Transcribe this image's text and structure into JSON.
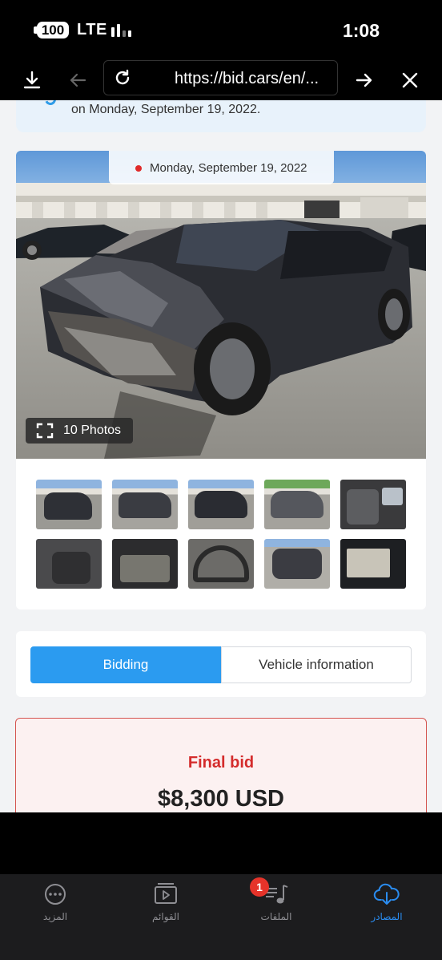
{
  "status_bar": {
    "battery": "100",
    "network": "LTE",
    "time": "1:08"
  },
  "browser": {
    "url": "https://bid.cars/en/..."
  },
  "page": {
    "date_notice": "on Monday, September 19, 2022.",
    "photo_date": "Monday, September 19, 2022",
    "photos_count_label": "10 Photos",
    "tabs": [
      {
        "label": "Bidding",
        "active": true
      },
      {
        "label": "Vehicle information",
        "active": false
      }
    ],
    "final_bid_label": "Final bid",
    "final_bid_value": "$8,300 USD"
  },
  "bottom_nav": {
    "items": [
      {
        "label": "المزيد",
        "icon": "more-icon"
      },
      {
        "label": "القوائم",
        "icon": "playlist-icon"
      },
      {
        "label": "الملفات",
        "icon": "music-files-icon",
        "badge": "1"
      },
      {
        "label": "المصادر",
        "icon": "cloud-download-icon",
        "active": true
      }
    ]
  },
  "colors": {
    "accent": "#2b9bf0",
    "final_bid": "#d42c2c",
    "nav_active": "#2a8cf0"
  }
}
